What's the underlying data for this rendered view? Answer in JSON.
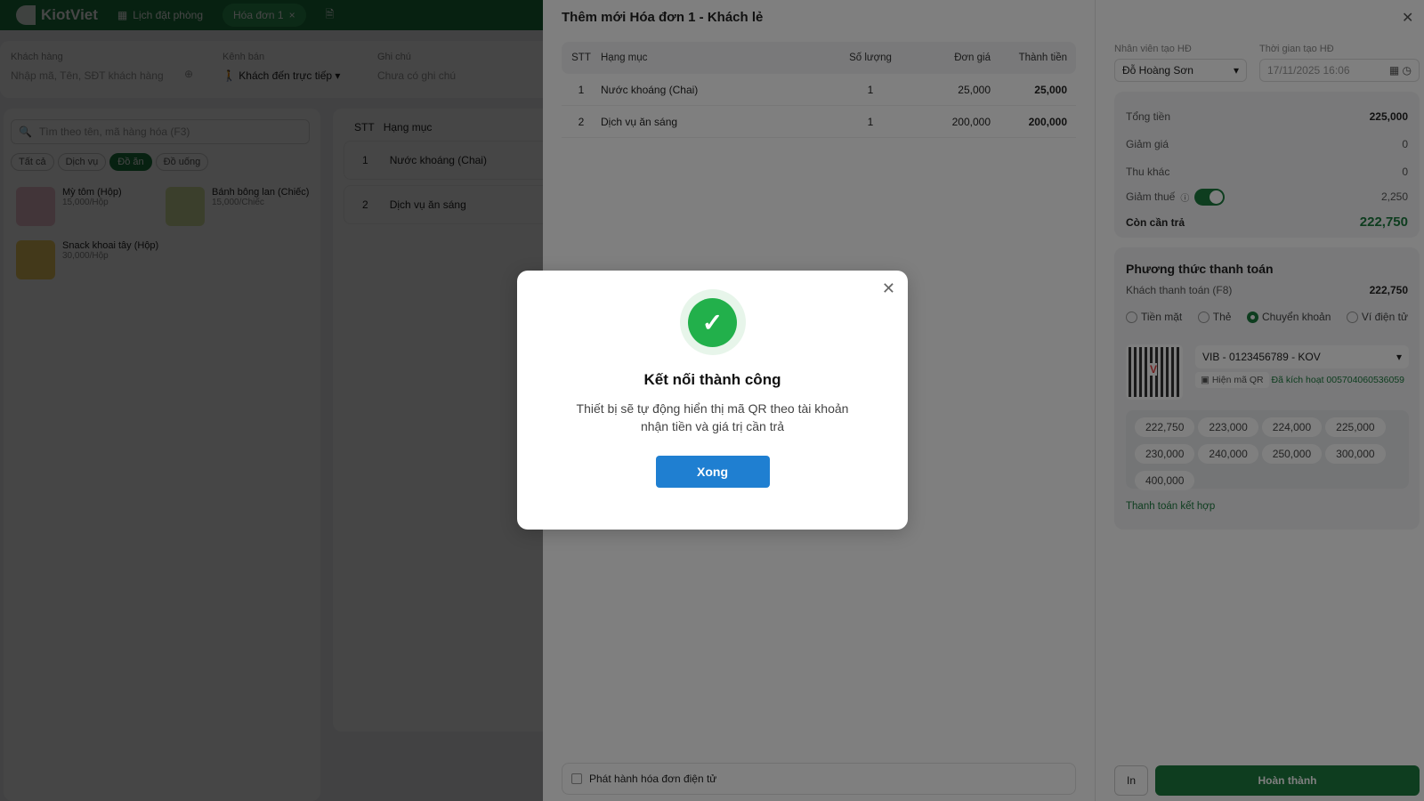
{
  "topbar": {
    "brand": "KiotViet",
    "tabs": [
      {
        "label": "Lịch đặt phòng"
      },
      {
        "label": "Hóa đơn 1"
      }
    ]
  },
  "customer": {
    "label": "Khách hàng",
    "placeholder": "Nhập mã, Tên, SĐT khách hàng",
    "channel_label": "Kênh bán",
    "channel_value": "Khách đến trực tiếp",
    "note_label": "Ghi chú",
    "note_placeholder": "Chưa có ghi chú"
  },
  "products": {
    "search_placeholder": "Tìm theo tên, mã hàng hóa (F3)",
    "filters": [
      "Tất cả",
      "Dịch vụ",
      "Đồ ăn",
      "Đồ uống"
    ],
    "items": [
      {
        "name": "Mỳ tôm (Hộp)",
        "price": "15,000/Hộp"
      },
      {
        "name": "Bánh bông lan (Chiếc)",
        "price": "15,000/Chiếc"
      },
      {
        "name": "Snack khoai tây (Hộp)",
        "price": "30,000/Hộp"
      }
    ]
  },
  "cart": {
    "headers": [
      "STT",
      "Hạng mục"
    ],
    "rows": [
      {
        "stt": "1",
        "name": "Nước khoáng (Chai)"
      },
      {
        "stt": "2",
        "name": "Dịch vụ ăn sáng"
      }
    ]
  },
  "drawer": {
    "title": "Thêm mới Hóa đơn 1 - Khách lẻ",
    "table": {
      "headers": [
        "STT",
        "Hạng mục",
        "Số lượng",
        "Đơn giá",
        "Thành tiền"
      ],
      "rows": [
        {
          "stt": "1",
          "name": "Nước khoáng (Chai)",
          "qty": "1",
          "price": "25,000",
          "total": "25,000"
        },
        {
          "stt": "2",
          "name": "Dịch vụ ăn sáng",
          "qty": "1",
          "price": "200,000",
          "total": "200,000"
        }
      ]
    },
    "einvoice_label": "Phát hành hóa đơn điện tử",
    "staff_label": "Nhân viên tạo HĐ",
    "staff_value": "Đỗ Hoàng Sơn",
    "time_label": "Thời gian tạo HĐ",
    "time_value": "17/11/2025 16:06",
    "summary": {
      "total_label": "Tổng tiền",
      "total": "225,000",
      "discount_label": "Giảm giá",
      "discount": "0",
      "other_label": "Thu khác",
      "other": "0",
      "tax_label": "Giảm thuế",
      "tax": "2,250",
      "tax_enabled": true,
      "due_label": "Còn cần trả",
      "due": "222,750"
    },
    "payment": {
      "title": "Phương thức thanh toán",
      "paid_label": "Khách thanh toán (F8)",
      "paid": "222,750",
      "methods": [
        "Tiền mặt",
        "Thẻ",
        "Chuyển khoản",
        "Ví điện tử"
      ],
      "selected": "Chuyển khoản",
      "account": "VIB - 0123456789 - KOV",
      "show_qr": "Hiện mã QR",
      "activated": "Đã kích hoạt 005704060536059",
      "amounts": [
        "222,750",
        "223,000",
        "224,000",
        "225,000",
        "230,000",
        "240,000",
        "250,000",
        "300,000",
        "400,000"
      ],
      "combined": "Thanh toán kết hợp"
    },
    "print_label": "In",
    "complete_label": "Hoàn thành"
  },
  "modal": {
    "title": "Kết nối thành công",
    "message": "Thiết bị sẽ tự động hiển thị mã QR theo tài khoản nhận tiền và giá trị cần trả",
    "button": "Xong"
  },
  "colors": {
    "brand": "#1c7a3e",
    "success": "#22b04b",
    "primary": "#1f7fd1"
  }
}
